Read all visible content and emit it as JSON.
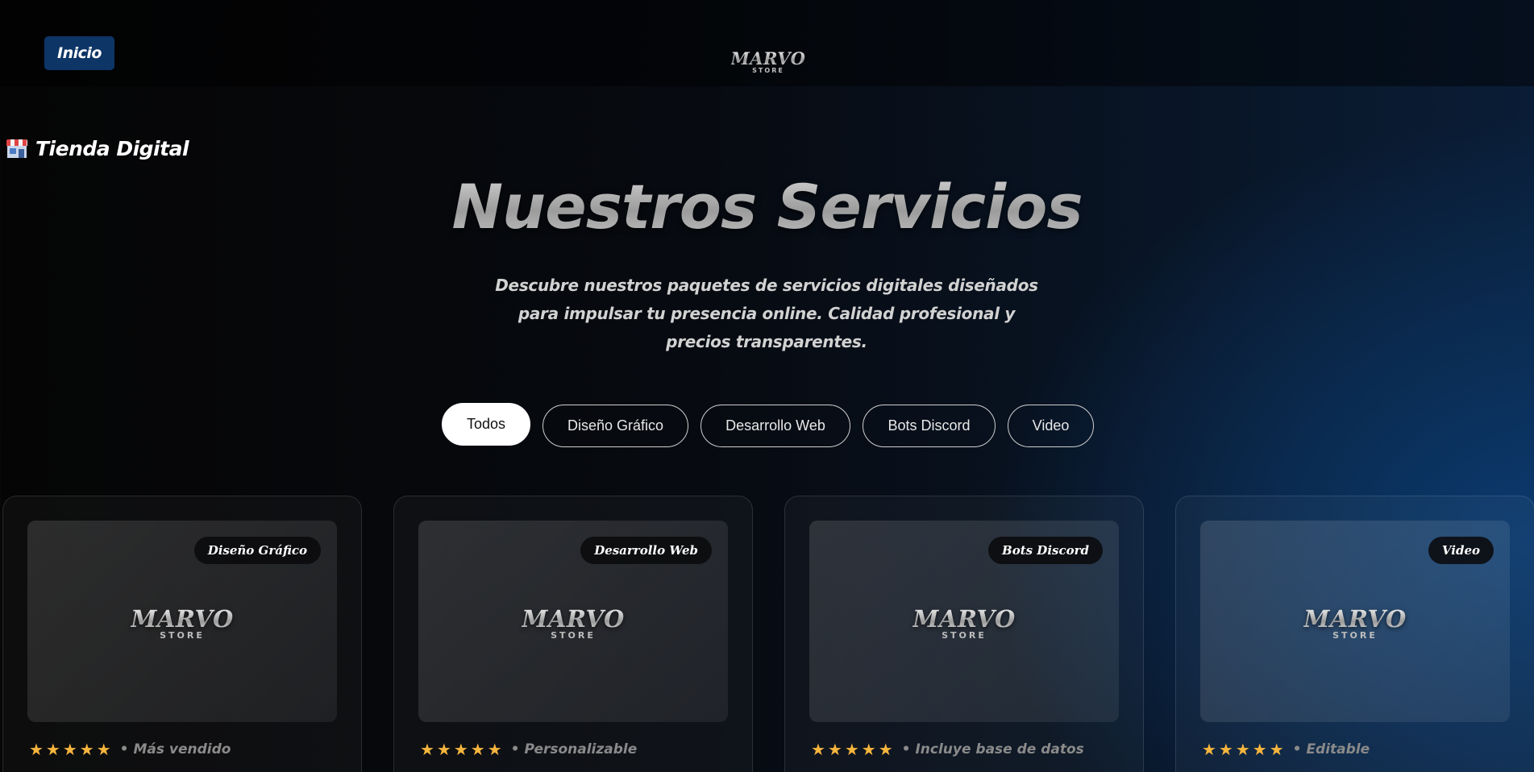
{
  "nav": {
    "home_label": "Inicio"
  },
  "logo": {
    "line1": "MARVO",
    "line2": "STORE"
  },
  "store": {
    "label": "Tienda Digital",
    "icon": "store-icon"
  },
  "hero": {
    "title": "Nuestros Servicios",
    "subtitle": "Descubre nuestros paquetes de servicios digitales diseñados para impulsar tu presencia online. Calidad profesional y precios transparentes."
  },
  "filters": [
    {
      "label": "Todos",
      "active": true
    },
    {
      "label": "Diseño Gráfico",
      "active": false
    },
    {
      "label": "Desarrollo Web",
      "active": false
    },
    {
      "label": "Bots Discord",
      "active": false
    },
    {
      "label": "Video",
      "active": false
    }
  ],
  "cards": [
    {
      "badge": "Diseño Gráfico",
      "stars": "★★★★★",
      "rating": 5,
      "note": "• Más vendido"
    },
    {
      "badge": "Desarrollo Web",
      "stars": "★★★★★",
      "rating": 5,
      "note": "• Personalizable"
    },
    {
      "badge": "Bots Discord",
      "stars": "★★★★★",
      "rating": 5,
      "note": "• Incluye base de datos"
    },
    {
      "badge": "Video",
      "stars": "★★★★★",
      "rating": 5,
      "note": "• Editable"
    }
  ],
  "colors": {
    "accent": "#0d3566",
    "star": "#f6b53d",
    "background_glow": "#0b3a6e"
  }
}
